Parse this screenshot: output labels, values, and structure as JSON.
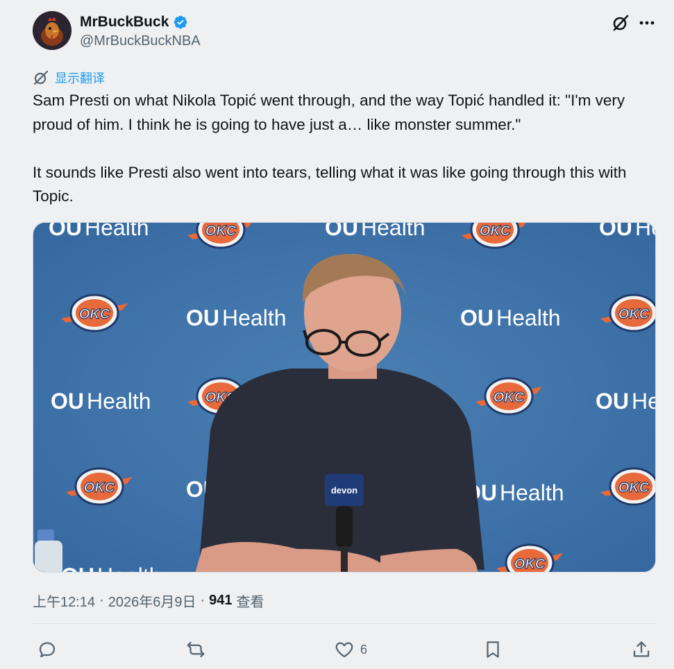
{
  "author": {
    "name": "MrBuckBuck",
    "handle": "@MrBuckBuckNBA"
  },
  "translate_label": "显示翻译",
  "tweet_text": "Sam Presti on what Nikola Topić went through, and the way Topić handled it: \"I'm very proud of him. I think he is going to have just a… like monster summer.\"\n\nIt sounds like Presti also went into tears, telling what it was like going through this with Topic.",
  "media": {
    "backdrop_sponsor": "OU Health",
    "backdrop_team": "OKC",
    "mic_label": "devon"
  },
  "meta": {
    "time": "上午12:14",
    "date": "2026年6月9日",
    "views_count": "941",
    "views_label": "查看"
  },
  "actions": {
    "like_count": "6"
  },
  "colors": {
    "accent": "#1d9bf0",
    "verified": "#1d9bf0",
    "backdrop_blue": "#3f74a7"
  }
}
